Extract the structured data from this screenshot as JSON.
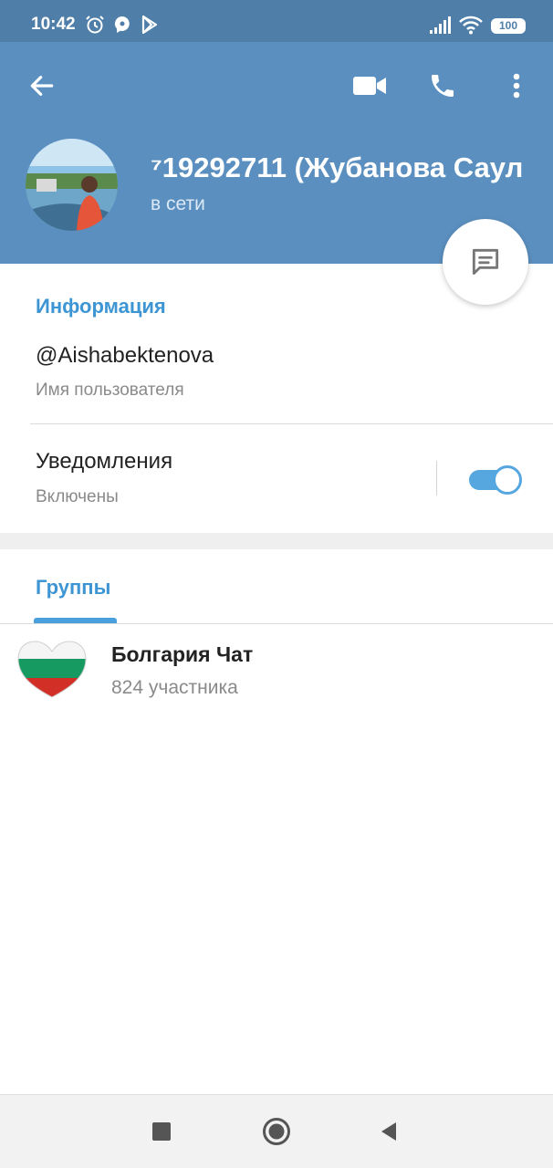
{
  "status_bar": {
    "time": "10:42",
    "battery": "100",
    "icons": [
      "alarm-icon",
      "messenger-icon",
      "play-store-icon",
      "signal-icon",
      "wifi-icon",
      "battery-icon"
    ]
  },
  "header": {
    "back_icon": "arrow-left-icon",
    "actions": [
      "video-call-icon",
      "phone-icon",
      "more-vert-icon"
    ],
    "name": "⁷19292711 (Жубанова Саул",
    "status": "в сети",
    "fab_icon": "message-icon"
  },
  "info": {
    "title": "Информация",
    "username": "@Aishabektenova",
    "username_label": "Имя пользователя",
    "notifications": "Уведомления",
    "notifications_state": "Включены",
    "notifications_enabled": true
  },
  "groups": {
    "title": "Группы",
    "items": [
      {
        "name": "Болгария Чат",
        "members": "824 участника"
      }
    ]
  },
  "nav_bar": {
    "buttons": [
      "recents-icon",
      "home-icon",
      "back-icon"
    ]
  },
  "colors": {
    "header": "#5b8fbf",
    "status_bar": "#4f7fa8",
    "accent": "#3e95d3"
  }
}
